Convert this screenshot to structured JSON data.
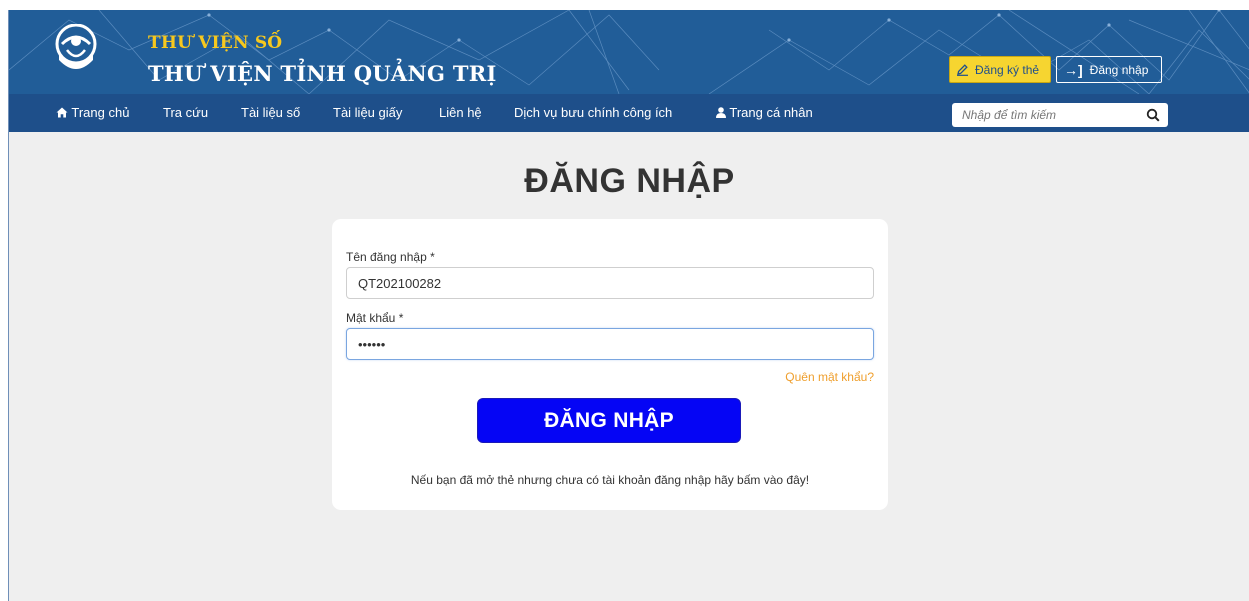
{
  "header": {
    "subtitle": "THƯ VIỆN SỐ",
    "title": "THƯ VIỆN TỈNH QUẢNG TRỊ",
    "register_label": "Đăng ký thẻ",
    "login_label": "Đăng nhập",
    "login_icon": "→]",
    "colors": {
      "banner": "#215d98",
      "accent_yellow": "#f7c81e"
    }
  },
  "nav": {
    "items": [
      "Trang chủ",
      "Tra cứu",
      "Tài liệu số",
      "Tài liệu giấy",
      "Liên hệ",
      "Dịch vụ bưu chính công ích",
      "Trang cá nhân"
    ],
    "search_placeholder": "Nhập để tìm kiếm",
    "icons": {
      "home": "home-icon",
      "user": "user-icon",
      "search": "search-icon"
    }
  },
  "login": {
    "page_title": "ĐĂNG NHẬP",
    "username_label": "Tên đăng nhập *",
    "username_value": "QT202100282",
    "password_label": "Mật khẩu *",
    "password_value": "••••••",
    "forgot_label": "Quên mật khẩu?",
    "submit_label": "ĐĂNG NHẬP",
    "note": "Nếu bạn đã mở thẻ nhưng chưa có tài khoản đăng nhập hãy bấm vào đây!",
    "colors": {
      "submit_bg": "#0505f5",
      "forgot": "#ef9f2d"
    }
  }
}
